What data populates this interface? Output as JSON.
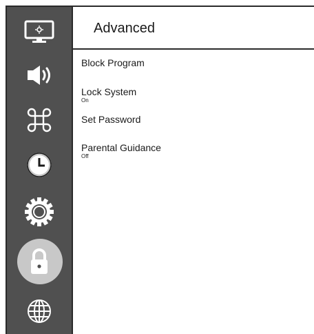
{
  "sidebar": {
    "icons": [
      {
        "name": "picture-icon"
      },
      {
        "name": "sound-icon"
      },
      {
        "name": "command-icon"
      },
      {
        "name": "clock-icon"
      },
      {
        "name": "settings-icon"
      },
      {
        "name": "lock-icon",
        "selected": true
      },
      {
        "name": "network-icon"
      }
    ]
  },
  "page": {
    "title": "Advanced"
  },
  "menu": {
    "items": [
      {
        "label": "Block Program",
        "value": ""
      },
      {
        "label": "Lock System",
        "value": "On"
      },
      {
        "label": "Set Password",
        "value": ""
      },
      {
        "label": "Parental Guidance",
        "value": "Off"
      }
    ]
  },
  "colors": {
    "sidebar_bg": "#505050",
    "icon": "#ffffff",
    "selected_bg": "#c8c8c8",
    "text": "#1a1a1a"
  }
}
